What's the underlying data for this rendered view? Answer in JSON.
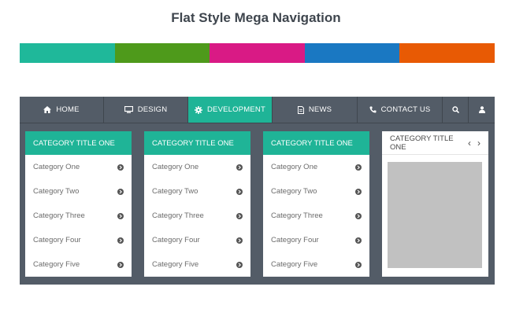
{
  "page": {
    "title": "Flat Style Mega Navigation"
  },
  "color_bar": {
    "colors": [
      "#1fb89a",
      "#4e9a1b",
      "#d91a85",
      "#1a78c2",
      "#e85a04"
    ]
  },
  "nav": {
    "items": [
      {
        "label": "HOME",
        "icon": "home-icon"
      },
      {
        "label": "DESIGN",
        "icon": "monitor-icon"
      },
      {
        "label": "DEVELOPMENT",
        "icon": "gear-icon",
        "active": true
      },
      {
        "label": "NEWS",
        "icon": "document-icon"
      },
      {
        "label": "CONTACT US",
        "icon": "phone-icon"
      }
    ],
    "search_icon": "search-icon",
    "user_icon": "user-icon"
  },
  "panels": [
    {
      "title": "CATEGORY TITLE ONE",
      "items": [
        "Category One",
        "Category Two",
        "Category Three",
        "Category Four",
        "Category Five"
      ]
    },
    {
      "title": "CATEGORY TITLE ONE",
      "items": [
        "Category One",
        "Category Two",
        "Category Three",
        "Category Four",
        "Category Five"
      ]
    },
    {
      "title": "CATEGORY TITLE ONE",
      "items": [
        "Category One",
        "Category Two",
        "Category Three",
        "Category Four",
        "Category Five"
      ]
    }
  ],
  "media_panel": {
    "title": "CATEGORY TITLE ONE",
    "prev": "‹",
    "next": "›"
  },
  "colors": {
    "accent": "#1fb497",
    "nav_bg": "#535c67",
    "placeholder": "#c1c1c1"
  }
}
